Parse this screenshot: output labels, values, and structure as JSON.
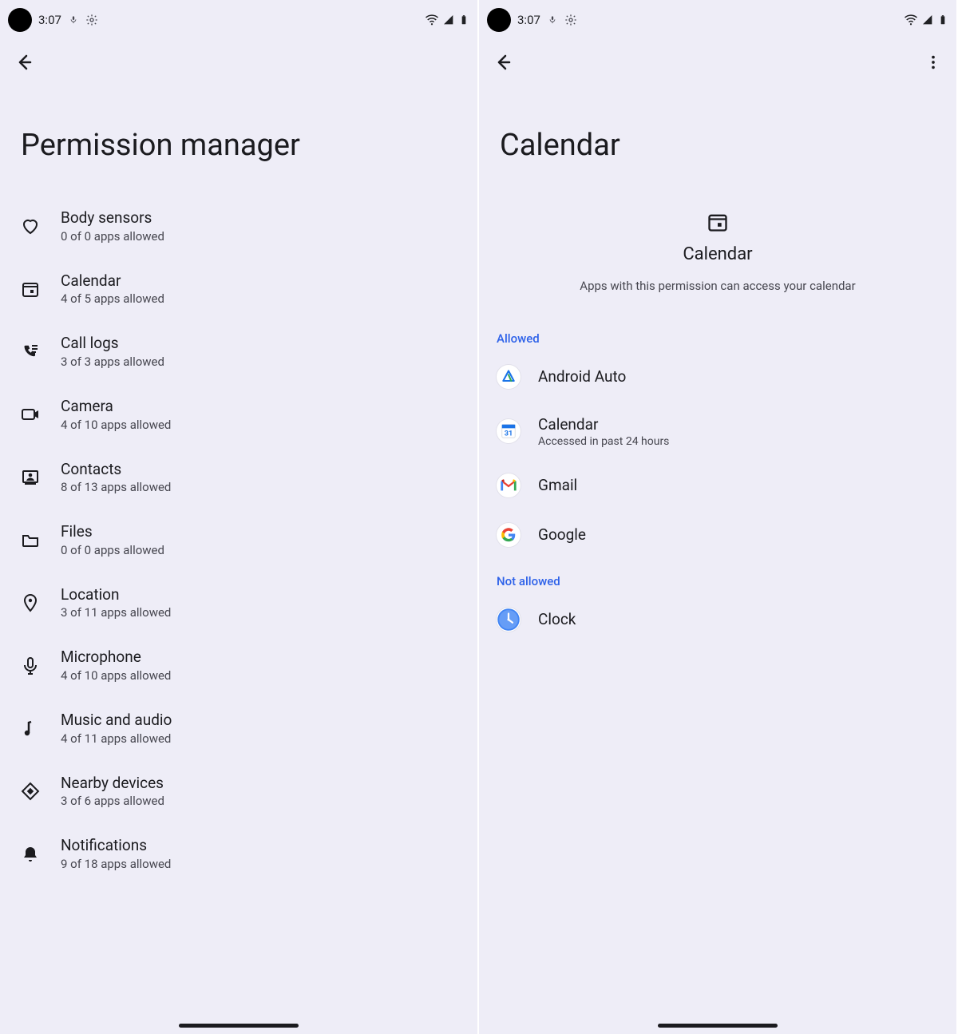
{
  "status": {
    "time": "3:07"
  },
  "left": {
    "title": "Permission manager",
    "items": [
      {
        "label": "Body sensors",
        "sub": "0 of 0 apps allowed",
        "icon": "heart"
      },
      {
        "label": "Calendar",
        "sub": "4 of 5 apps allowed",
        "icon": "calendar"
      },
      {
        "label": "Call logs",
        "sub": "3 of 3 apps allowed",
        "icon": "calllog"
      },
      {
        "label": "Camera",
        "sub": "4 of 10 apps allowed",
        "icon": "camera"
      },
      {
        "label": "Contacts",
        "sub": "8 of 13 apps allowed",
        "icon": "contacts"
      },
      {
        "label": "Files",
        "sub": "0 of 0 apps allowed",
        "icon": "folder"
      },
      {
        "label": "Location",
        "sub": "3 of 11 apps allowed",
        "icon": "location"
      },
      {
        "label": "Microphone",
        "sub": "4 of 10 apps allowed",
        "icon": "mic"
      },
      {
        "label": "Music and audio",
        "sub": "4 of 11 apps allowed",
        "icon": "music"
      },
      {
        "label": "Nearby devices",
        "sub": "3 of 6 apps allowed",
        "icon": "nearby"
      },
      {
        "label": "Notifications",
        "sub": "9 of 18 apps allowed",
        "icon": "bell"
      }
    ]
  },
  "right": {
    "title": "Calendar",
    "hero_name": "Calendar",
    "hero_desc": "Apps with this permission can access your calendar",
    "section_allowed": "Allowed",
    "section_not_allowed": "Not allowed",
    "allowed": [
      {
        "label": "Android Auto",
        "sub": "",
        "icon": "auto"
      },
      {
        "label": "Calendar",
        "sub": "Accessed in past 24 hours",
        "icon": "gcal"
      },
      {
        "label": "Gmail",
        "sub": "",
        "icon": "gmail"
      },
      {
        "label": "Google",
        "sub": "",
        "icon": "google"
      }
    ],
    "not_allowed": [
      {
        "label": "Clock",
        "sub": "",
        "icon": "clock"
      }
    ]
  }
}
